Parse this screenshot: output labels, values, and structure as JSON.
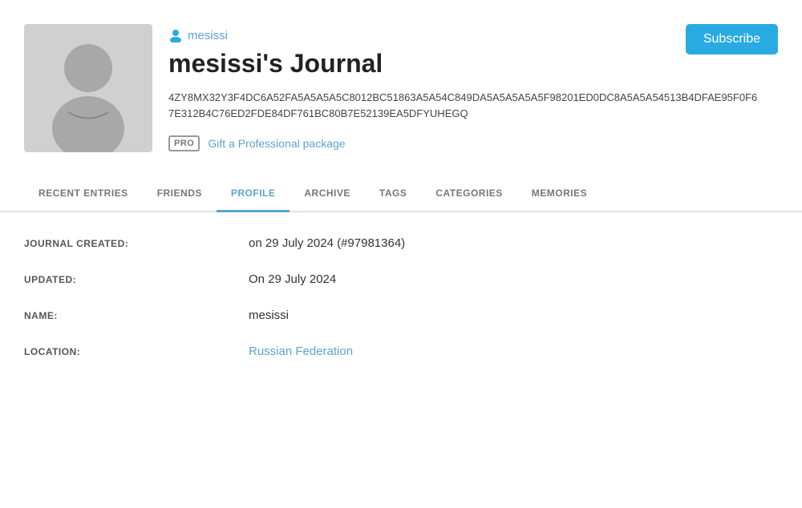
{
  "header": {
    "username": "mesissi",
    "username_icon": "user-icon",
    "journal_title": "mesissi's Journal",
    "hash_code": "4ZY8MX32Y3F4DC6A52FA5A5A5A5C8012BC51863A5A54C849DA5A5A5A5A5F98201ED0DC8A5A5A54513B4DFAE95F0F67E312B4C76ED2FDE84DF761BC80B7E52139EA5DFYUHEGQ",
    "pro_badge": "PRO",
    "gift_link": "Gift a Professional package",
    "subscribe_button": "Subscribe"
  },
  "nav": {
    "tabs": [
      {
        "id": "recent-entries",
        "label": "RECENT ENTRIES",
        "active": false
      },
      {
        "id": "friends",
        "label": "FRIENDS",
        "active": false
      },
      {
        "id": "profile",
        "label": "PROFILE",
        "active": true
      },
      {
        "id": "archive",
        "label": "ARCHIVE",
        "active": false
      },
      {
        "id": "tags",
        "label": "TAGS",
        "active": false
      },
      {
        "id": "categories",
        "label": "CATEGORIES",
        "active": false
      },
      {
        "id": "memories",
        "label": "MEMORIES",
        "active": false
      }
    ]
  },
  "profile": {
    "fields": [
      {
        "id": "journal-created",
        "label": "JOURNAL CREATED:",
        "value": "on 29 July 2024 (#97981364)",
        "is_link": false
      },
      {
        "id": "updated",
        "label": "UPDATED:",
        "value": "On 29 July 2024",
        "is_link": false
      },
      {
        "id": "name",
        "label": "NAME:",
        "value": "mesissi",
        "is_link": false
      },
      {
        "id": "location",
        "label": "LOCATION:",
        "value": "Russian Federation",
        "is_link": true
      }
    ]
  },
  "colors": {
    "accent": "#29abe2",
    "link": "#5ba4cf",
    "tab_active": "#5ba4cf",
    "label": "#555",
    "border": "#e0e0e0"
  }
}
